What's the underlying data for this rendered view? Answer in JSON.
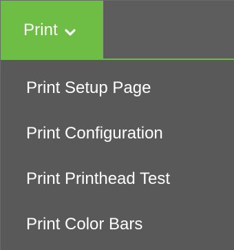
{
  "menu": {
    "tab_label": "Print",
    "tab_icon": "chevron-down-icon",
    "accent_color": "#6ebd45",
    "background_color": "#595959",
    "items": [
      {
        "label": "Print Setup Page"
      },
      {
        "label": "Print Configuration"
      },
      {
        "label": "Print Printhead Test"
      },
      {
        "label": "Print Color Bars"
      }
    ]
  }
}
